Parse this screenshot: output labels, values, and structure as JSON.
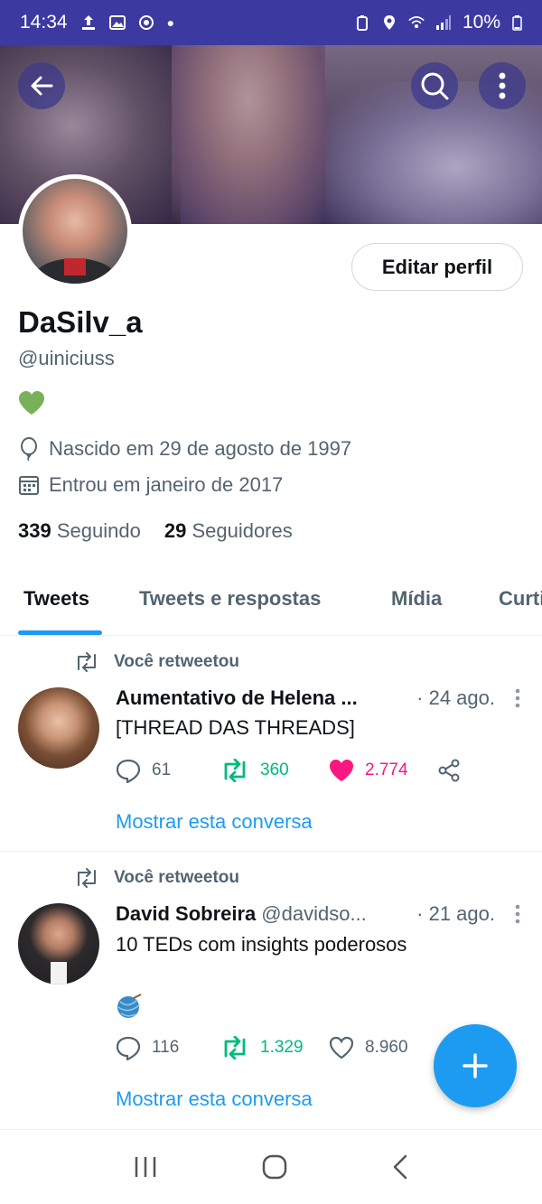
{
  "status_bar": {
    "time": "14:34",
    "battery": "10%"
  },
  "profile": {
    "edit_label": "Editar perfil",
    "display_name": "DaSilv_a",
    "handle": "@uiniciuss",
    "bio_emoji": "💚",
    "birth": "Nascido em 29 de agosto de 1997",
    "joined": "Entrou em janeiro de 2017",
    "following_count": "339",
    "following_label": "Seguindo",
    "followers_count": "29",
    "followers_label": "Seguidores"
  },
  "tabs": [
    {
      "label": "Tweets"
    },
    {
      "label": "Tweets e respostas"
    },
    {
      "label": "Mídia"
    },
    {
      "label": "Curtidas"
    }
  ],
  "tweets": [
    {
      "retweet_label": "Você retweetou",
      "name": "Aumentativo de Helena ...",
      "user": "",
      "time": "· 24 ago.",
      "text": "[THREAD DAS THREADS]",
      "replies": "61",
      "retweets": "360",
      "likes": "2.774",
      "show_conversation": "Mostrar esta conversa"
    },
    {
      "retweet_label": "Você retweetou",
      "name": "David Sobreira",
      "user": "@davidso...",
      "time": "· 21 ago.",
      "text": "10 TEDs com insights poderosos",
      "emoji": "🧶",
      "replies": "116",
      "retweets": "1.329",
      "likes": "8.960",
      "show_conversation": "Mostrar esta conversa"
    }
  ],
  "colors": {
    "accent": "#1d9bf0",
    "retweet_green": "#00ba7c",
    "like_pink": "#f91880",
    "status_bar": "#3c3aa0"
  },
  "icons": {
    "back": "arrow-left-icon",
    "search": "search-icon",
    "more": "more-vertical-icon",
    "balloon": "balloon-icon",
    "calendar": "calendar-icon",
    "retweet": "retweet-icon",
    "reply": "reply-icon",
    "like": "heart-icon",
    "share": "share-icon",
    "compose": "plus-icon"
  }
}
